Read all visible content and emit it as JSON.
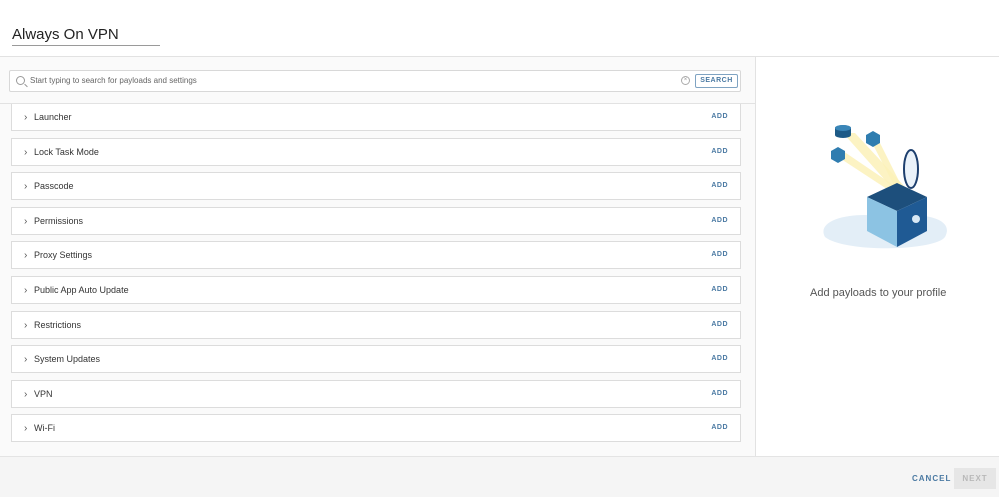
{
  "header": {
    "title": "Always On VPN"
  },
  "search": {
    "placeholder": "Start typing to search for payloads and settings",
    "button": "SEARCH"
  },
  "payloads": [
    {
      "label": "Launcher",
      "action": "ADD"
    },
    {
      "label": "Lock Task Mode",
      "action": "ADD"
    },
    {
      "label": "Passcode",
      "action": "ADD"
    },
    {
      "label": "Permissions",
      "action": "ADD"
    },
    {
      "label": "Proxy Settings",
      "action": "ADD"
    },
    {
      "label": "Public App Auto Update",
      "action": "ADD"
    },
    {
      "label": "Restrictions",
      "action": "ADD"
    },
    {
      "label": "System Updates",
      "action": "ADD"
    },
    {
      "label": "VPN",
      "action": "ADD"
    },
    {
      "label": "Wi-Fi",
      "action": "ADD"
    }
  ],
  "empty_state": {
    "message": "Add payloads to your profile"
  },
  "footer": {
    "cancel": "CANCEL",
    "next": "NEXT"
  }
}
